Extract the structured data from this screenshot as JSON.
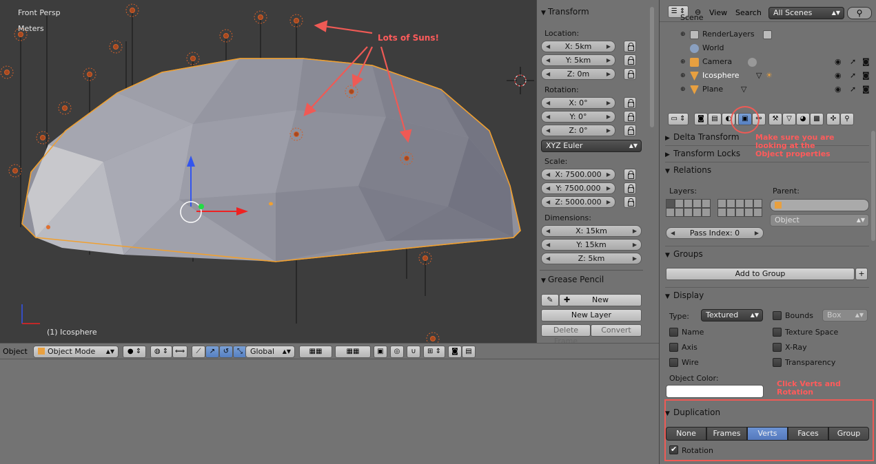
{
  "viewport": {
    "view_name": "Front Persp",
    "units": "Meters",
    "active_object": "(1) Icosphere",
    "annotation": "Lots of Suns!"
  },
  "npanel": {
    "transform_title": "Transform",
    "location_label": "Location:",
    "location": [
      "X: 5km",
      "Y: 5km",
      "Z: 0m"
    ],
    "rotation_label": "Rotation:",
    "rotation": [
      "X: 0°",
      "Y: 0°",
      "Z: 0°"
    ],
    "rotation_mode": "XYZ Euler",
    "scale_label": "Scale:",
    "scale": [
      "X: 7500.000",
      "Y: 7500.000",
      "Z: 5000.000"
    ],
    "dimensions_label": "Dimensions:",
    "dimensions": [
      "X: 15km",
      "Y: 15km",
      "Z: 5km"
    ],
    "grease_title": "Grease Pencil",
    "new_label": "New",
    "new_layer_label": "New Layer",
    "delete_frame_label": "Delete Frame",
    "convert_label": "Convert"
  },
  "header": {
    "menu_object": "Object",
    "mode": "Object Mode",
    "orientation": "Global"
  },
  "outliner": {
    "view_menu": "View",
    "search_menu": "Search",
    "scene_filter": "All Scenes",
    "items": [
      {
        "name": "Scene"
      },
      {
        "name": "RenderLayers"
      },
      {
        "name": "World"
      },
      {
        "name": "Camera"
      },
      {
        "name": "Icosphere"
      },
      {
        "name": "Plane"
      }
    ]
  },
  "properties": {
    "annotation_tab": "Make sure you are looking at the Object properties",
    "delta_transform": "Delta Transform",
    "transform_locks": "Transform Locks",
    "relations": "Relations",
    "layers_label": "Layers:",
    "parent_label": "Parent:",
    "parent_type": "Object",
    "pass_index": "Pass Index: 0",
    "groups": "Groups",
    "add_to_group": "Add to Group",
    "display": "Display",
    "type_label": "Type:",
    "type_value": "Textured",
    "bounds_label": "Bounds",
    "bounds_value": "Box",
    "name_label": "Name",
    "texture_space_label": "Texture Space",
    "axis_label": "Axis",
    "xray_label": "X-Ray",
    "wire_label": "Wire",
    "transparency_label": "Transparency",
    "object_color_label": "Object Color:",
    "annotation_click": "Click Verts and Rotation",
    "duplication": "Duplication",
    "dup_options": [
      "None",
      "Frames",
      "Verts",
      "Faces",
      "Group"
    ],
    "dup_selected": "Verts",
    "rotation_check_label": "Rotation"
  },
  "colors": {
    "accent_blue": "#5680c2",
    "annotation_red": "#ff5b5b",
    "viewport_bg": "#3d3d3d",
    "panel_bg": "#727272"
  }
}
